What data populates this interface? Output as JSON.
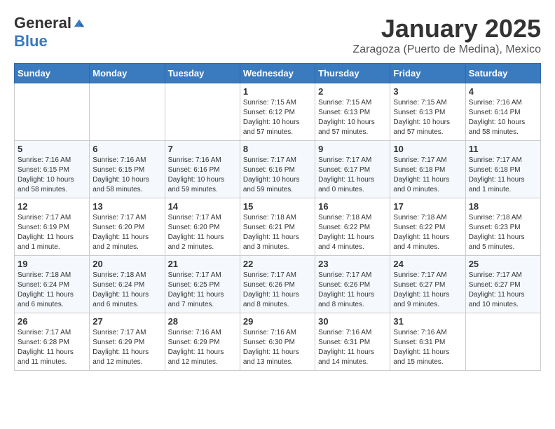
{
  "logo": {
    "general": "General",
    "blue": "Blue"
  },
  "header": {
    "month": "January 2025",
    "location": "Zaragoza (Puerto de Medina), Mexico"
  },
  "weekdays": [
    "Sunday",
    "Monday",
    "Tuesday",
    "Wednesday",
    "Thursday",
    "Friday",
    "Saturday"
  ],
  "weeks": [
    [
      {
        "day": "",
        "sunrise": "",
        "sunset": "",
        "daylight": ""
      },
      {
        "day": "",
        "sunrise": "",
        "sunset": "",
        "daylight": ""
      },
      {
        "day": "",
        "sunrise": "",
        "sunset": "",
        "daylight": ""
      },
      {
        "day": "1",
        "sunrise": "Sunrise: 7:15 AM",
        "sunset": "Sunset: 6:12 PM",
        "daylight": "Daylight: 10 hours and 57 minutes."
      },
      {
        "day": "2",
        "sunrise": "Sunrise: 7:15 AM",
        "sunset": "Sunset: 6:13 PM",
        "daylight": "Daylight: 10 hours and 57 minutes."
      },
      {
        "day": "3",
        "sunrise": "Sunrise: 7:15 AM",
        "sunset": "Sunset: 6:13 PM",
        "daylight": "Daylight: 10 hours and 57 minutes."
      },
      {
        "day": "4",
        "sunrise": "Sunrise: 7:16 AM",
        "sunset": "Sunset: 6:14 PM",
        "daylight": "Daylight: 10 hours and 58 minutes."
      }
    ],
    [
      {
        "day": "5",
        "sunrise": "Sunrise: 7:16 AM",
        "sunset": "Sunset: 6:15 PM",
        "daylight": "Daylight: 10 hours and 58 minutes."
      },
      {
        "day": "6",
        "sunrise": "Sunrise: 7:16 AM",
        "sunset": "Sunset: 6:15 PM",
        "daylight": "Daylight: 10 hours and 58 minutes."
      },
      {
        "day": "7",
        "sunrise": "Sunrise: 7:16 AM",
        "sunset": "Sunset: 6:16 PM",
        "daylight": "Daylight: 10 hours and 59 minutes."
      },
      {
        "day": "8",
        "sunrise": "Sunrise: 7:17 AM",
        "sunset": "Sunset: 6:16 PM",
        "daylight": "Daylight: 10 hours and 59 minutes."
      },
      {
        "day": "9",
        "sunrise": "Sunrise: 7:17 AM",
        "sunset": "Sunset: 6:17 PM",
        "daylight": "Daylight: 11 hours and 0 minutes."
      },
      {
        "day": "10",
        "sunrise": "Sunrise: 7:17 AM",
        "sunset": "Sunset: 6:18 PM",
        "daylight": "Daylight: 11 hours and 0 minutes."
      },
      {
        "day": "11",
        "sunrise": "Sunrise: 7:17 AM",
        "sunset": "Sunset: 6:18 PM",
        "daylight": "Daylight: 11 hours and 1 minute."
      }
    ],
    [
      {
        "day": "12",
        "sunrise": "Sunrise: 7:17 AM",
        "sunset": "Sunset: 6:19 PM",
        "daylight": "Daylight: 11 hours and 1 minute."
      },
      {
        "day": "13",
        "sunrise": "Sunrise: 7:17 AM",
        "sunset": "Sunset: 6:20 PM",
        "daylight": "Daylight: 11 hours and 2 minutes."
      },
      {
        "day": "14",
        "sunrise": "Sunrise: 7:17 AM",
        "sunset": "Sunset: 6:20 PM",
        "daylight": "Daylight: 11 hours and 2 minutes."
      },
      {
        "day": "15",
        "sunrise": "Sunrise: 7:18 AM",
        "sunset": "Sunset: 6:21 PM",
        "daylight": "Daylight: 11 hours and 3 minutes."
      },
      {
        "day": "16",
        "sunrise": "Sunrise: 7:18 AM",
        "sunset": "Sunset: 6:22 PM",
        "daylight": "Daylight: 11 hours and 4 minutes."
      },
      {
        "day": "17",
        "sunrise": "Sunrise: 7:18 AM",
        "sunset": "Sunset: 6:22 PM",
        "daylight": "Daylight: 11 hours and 4 minutes."
      },
      {
        "day": "18",
        "sunrise": "Sunrise: 7:18 AM",
        "sunset": "Sunset: 6:23 PM",
        "daylight": "Daylight: 11 hours and 5 minutes."
      }
    ],
    [
      {
        "day": "19",
        "sunrise": "Sunrise: 7:18 AM",
        "sunset": "Sunset: 6:24 PM",
        "daylight": "Daylight: 11 hours and 6 minutes."
      },
      {
        "day": "20",
        "sunrise": "Sunrise: 7:18 AM",
        "sunset": "Sunset: 6:24 PM",
        "daylight": "Daylight: 11 hours and 6 minutes."
      },
      {
        "day": "21",
        "sunrise": "Sunrise: 7:17 AM",
        "sunset": "Sunset: 6:25 PM",
        "daylight": "Daylight: 11 hours and 7 minutes."
      },
      {
        "day": "22",
        "sunrise": "Sunrise: 7:17 AM",
        "sunset": "Sunset: 6:26 PM",
        "daylight": "Daylight: 11 hours and 8 minutes."
      },
      {
        "day": "23",
        "sunrise": "Sunrise: 7:17 AM",
        "sunset": "Sunset: 6:26 PM",
        "daylight": "Daylight: 11 hours and 8 minutes."
      },
      {
        "day": "24",
        "sunrise": "Sunrise: 7:17 AM",
        "sunset": "Sunset: 6:27 PM",
        "daylight": "Daylight: 11 hours and 9 minutes."
      },
      {
        "day": "25",
        "sunrise": "Sunrise: 7:17 AM",
        "sunset": "Sunset: 6:27 PM",
        "daylight": "Daylight: 11 hours and 10 minutes."
      }
    ],
    [
      {
        "day": "26",
        "sunrise": "Sunrise: 7:17 AM",
        "sunset": "Sunset: 6:28 PM",
        "daylight": "Daylight: 11 hours and 11 minutes."
      },
      {
        "day": "27",
        "sunrise": "Sunrise: 7:17 AM",
        "sunset": "Sunset: 6:29 PM",
        "daylight": "Daylight: 11 hours and 12 minutes."
      },
      {
        "day": "28",
        "sunrise": "Sunrise: 7:16 AM",
        "sunset": "Sunset: 6:29 PM",
        "daylight": "Daylight: 11 hours and 12 minutes."
      },
      {
        "day": "29",
        "sunrise": "Sunrise: 7:16 AM",
        "sunset": "Sunset: 6:30 PM",
        "daylight": "Daylight: 11 hours and 13 minutes."
      },
      {
        "day": "30",
        "sunrise": "Sunrise: 7:16 AM",
        "sunset": "Sunset: 6:31 PM",
        "daylight": "Daylight: 11 hours and 14 minutes."
      },
      {
        "day": "31",
        "sunrise": "Sunrise: 7:16 AM",
        "sunset": "Sunset: 6:31 PM",
        "daylight": "Daylight: 11 hours and 15 minutes."
      },
      {
        "day": "",
        "sunrise": "",
        "sunset": "",
        "daylight": ""
      }
    ]
  ]
}
